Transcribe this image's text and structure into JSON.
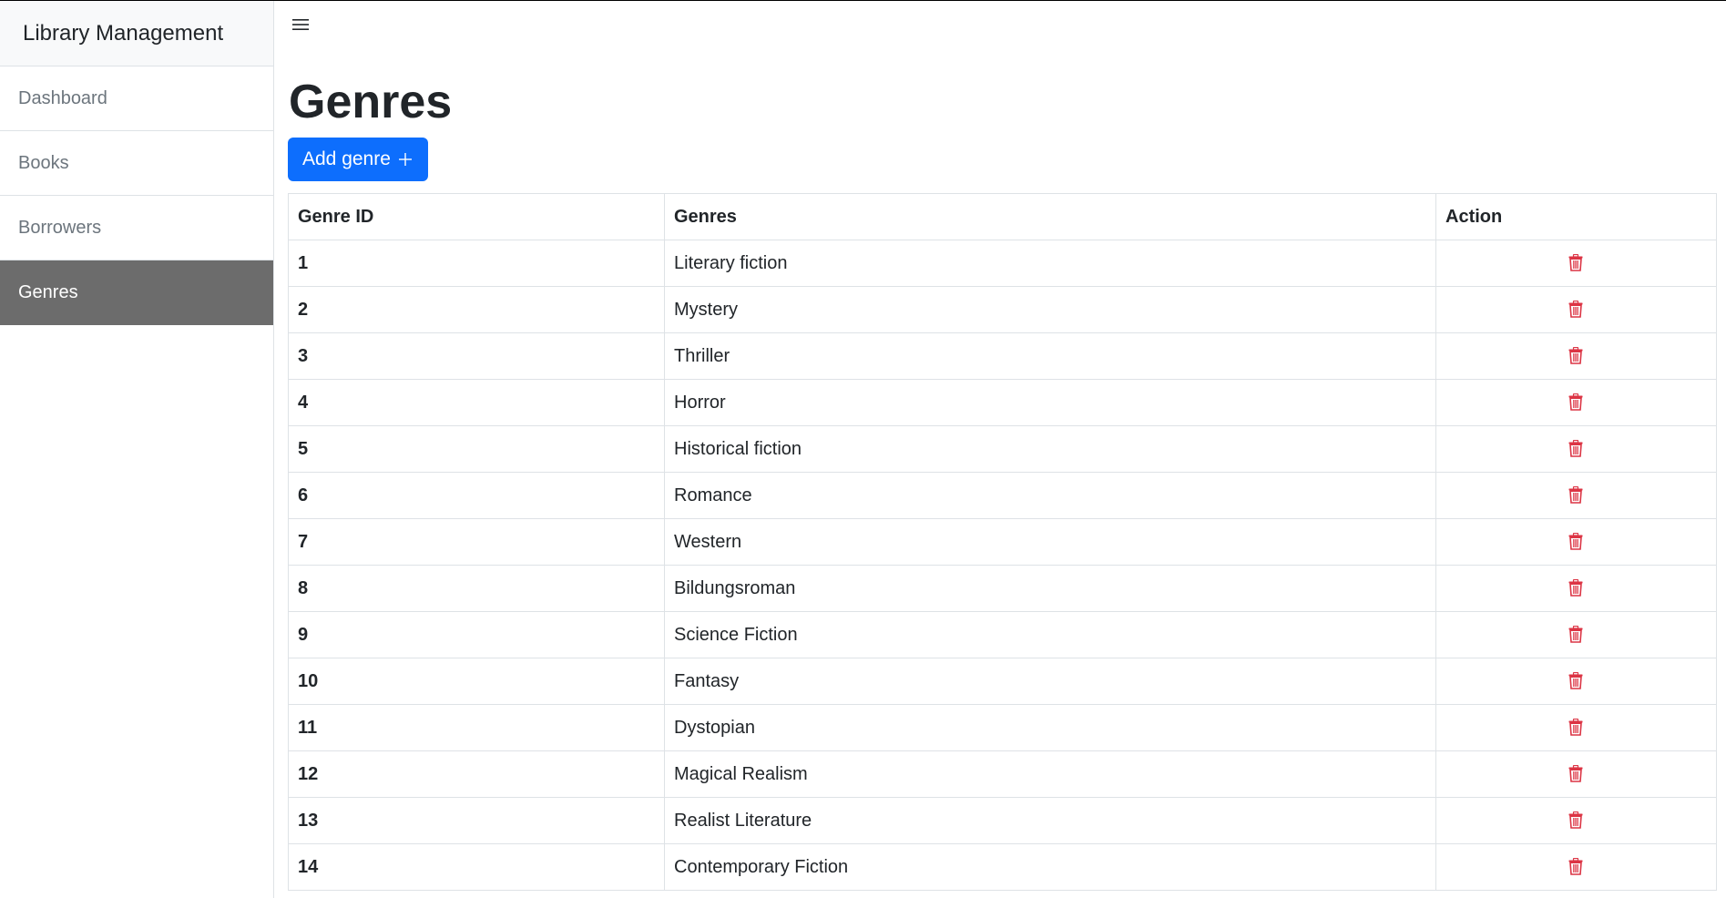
{
  "sidebar": {
    "brand": "Library Management",
    "items": [
      {
        "label": "Dashboard",
        "active": false
      },
      {
        "label": "Books",
        "active": false
      },
      {
        "label": "Borrowers",
        "active": false
      },
      {
        "label": "Genres",
        "active": true
      }
    ]
  },
  "header": {
    "menu_icon": "hamburger-menu-icon"
  },
  "main": {
    "title": "Genres",
    "add_button_label": "Add genre",
    "add_button_icon": "plus-icon"
  },
  "table": {
    "headers": [
      "Genre ID",
      "Genres",
      "Action"
    ],
    "rows": [
      {
        "id": "1",
        "genre": "Literary fiction"
      },
      {
        "id": "2",
        "genre": "Mystery"
      },
      {
        "id": "3",
        "genre": "Thriller"
      },
      {
        "id": "4",
        "genre": "Horror"
      },
      {
        "id": "5",
        "genre": "Historical fiction"
      },
      {
        "id": "6",
        "genre": "Romance"
      },
      {
        "id": "7",
        "genre": "Western"
      },
      {
        "id": "8",
        "genre": "Bildungsroman"
      },
      {
        "id": "9",
        "genre": "Science Fiction"
      },
      {
        "id": "10",
        "genre": "Fantasy"
      },
      {
        "id": "11",
        "genre": "Dystopian"
      },
      {
        "id": "12",
        "genre": "Magical Realism"
      },
      {
        "id": "13",
        "genre": "Realist Literature"
      },
      {
        "id": "14",
        "genre": "Contemporary Fiction"
      }
    ],
    "action_icon": "trash-icon"
  },
  "colors": {
    "primary": "#0d6efd",
    "active_nav": "#6c6c6c",
    "danger": "#dc3545",
    "border": "#dee2e6",
    "muted_text": "#6c757d"
  }
}
